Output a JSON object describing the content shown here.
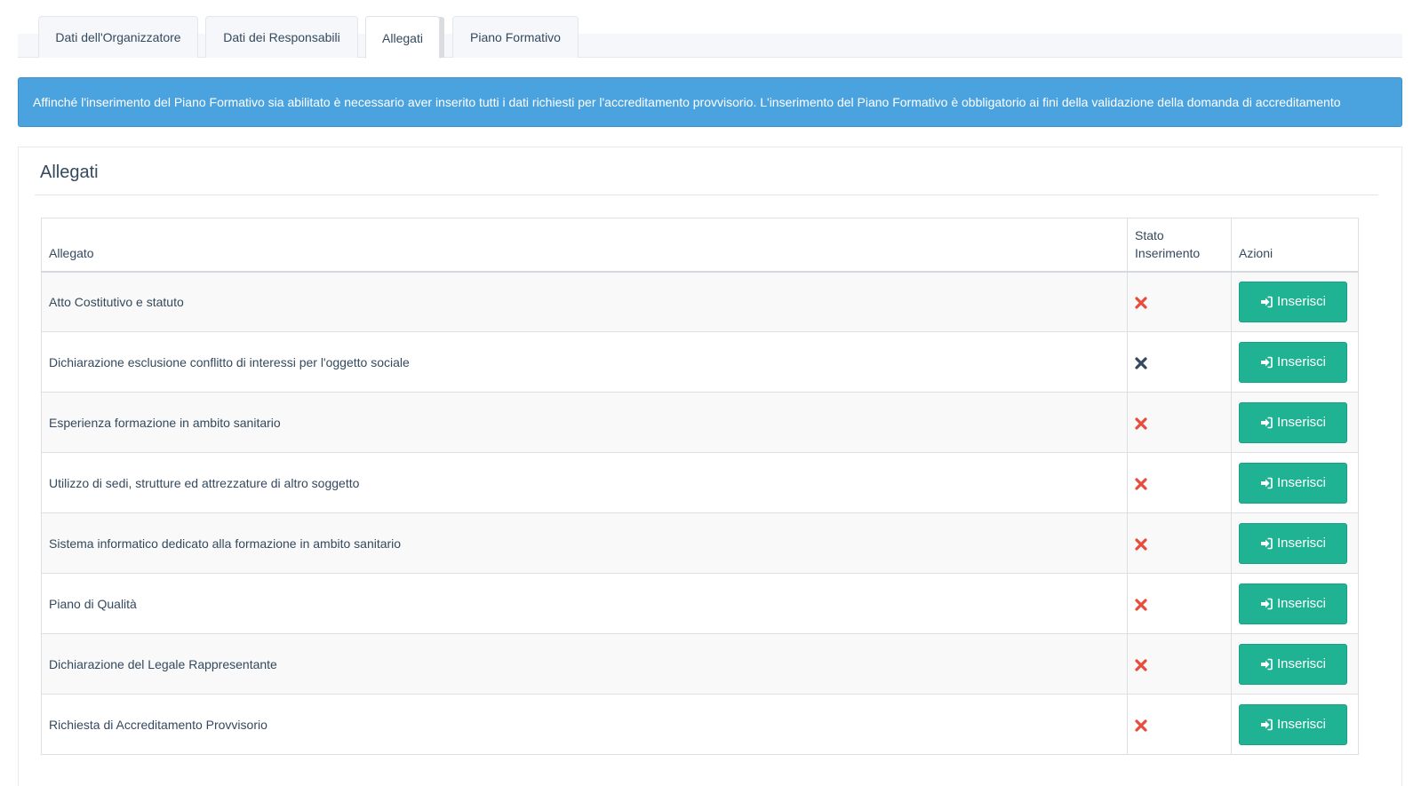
{
  "tabs": [
    {
      "label": "Dati dell'Organizzatore",
      "active": false
    },
    {
      "label": "Dati dei Responsabili",
      "active": false
    },
    {
      "label": "Allegati",
      "active": true
    },
    {
      "label": "Piano Formativo",
      "active": false
    }
  ],
  "alert": {
    "text": "Affinché l'inserimento del Piano Formativo sia abilitato è necessario aver inserito tutti i dati richiesti per l'accreditamento provvisorio. L'inserimento del Piano Formativo è obbligatorio ai fini della validazione della domanda di accreditamento"
  },
  "panel": {
    "title": "Allegati"
  },
  "table": {
    "headers": [
      "Allegato",
      "Stato\nInserimento",
      "Azioni"
    ],
    "rows": [
      {
        "name": "Atto Costitutivo e statuto",
        "status_icon": "x-icon-red",
        "action": "Inserisci"
      },
      {
        "name": "Dichiarazione esclusione conflitto di interessi per l'oggetto sociale",
        "status_icon": "x-icon-dark",
        "action": "Inserisci"
      },
      {
        "name": "Esperienza formazione in ambito sanitario",
        "status_icon": "x-icon-red",
        "action": "Inserisci"
      },
      {
        "name": "Utilizzo di sedi, strutture ed attrezzature di altro soggetto",
        "status_icon": "x-icon-red",
        "action": "Inserisci"
      },
      {
        "name": "Sistema informatico dedicato alla formazione in ambito sanitario",
        "status_icon": "x-icon-red",
        "action": "Inserisci"
      },
      {
        "name": "Piano di Qualità",
        "status_icon": "x-icon-red",
        "action": "Inserisci"
      },
      {
        "name": "Dichiarazione del Legale Rappresentante",
        "status_icon": "x-icon-red",
        "action": "Inserisci"
      },
      {
        "name": "Richiesta di Accreditamento Provvisorio",
        "status_icon": "x-icon-red",
        "action": "Inserisci"
      }
    ]
  },
  "colors": {
    "alert_bg": "#4aa3df",
    "button_bg": "#1fb394",
    "x_red": "#e74c3c",
    "x_dark": "#34495e"
  }
}
